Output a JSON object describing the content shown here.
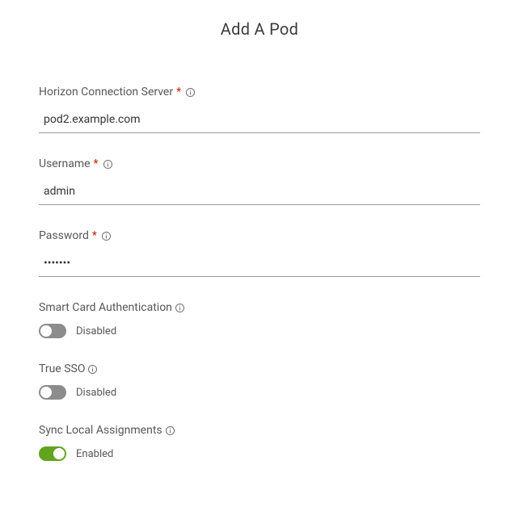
{
  "title": "Add A Pod",
  "fields": {
    "connectionServer": {
      "label": "Horizon Connection Server",
      "required": true,
      "value": "pod2.example.com"
    },
    "username": {
      "label": "Username",
      "required": true,
      "value": "admin"
    },
    "password": {
      "label": "Password",
      "required": true,
      "value": "•••••••"
    },
    "smartCard": {
      "label": "Smart Card Authentication",
      "enabled": false,
      "stateLabel": "Disabled"
    },
    "trueSso": {
      "label": "True SSO",
      "enabled": false,
      "stateLabel": "Disabled"
    },
    "syncLocal": {
      "label": "Sync Local Assignments",
      "enabled": true,
      "stateLabel": "Enabled"
    }
  },
  "glyphs": {
    "requiredMark": "*"
  }
}
